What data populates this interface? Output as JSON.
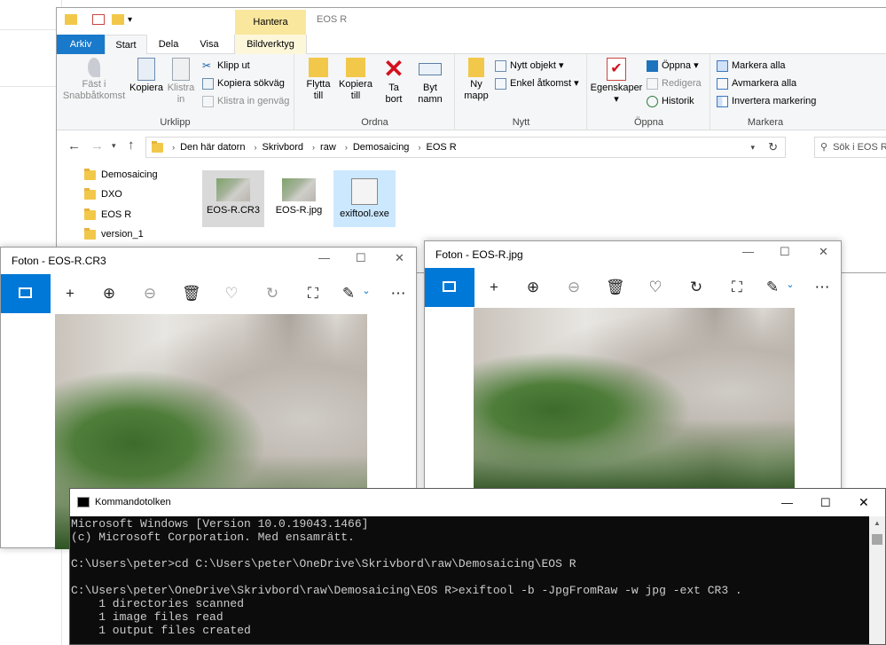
{
  "explorer": {
    "window_title": "EOS R",
    "tool_tab_header": "Hantera",
    "tabs": [
      {
        "label": "Arkiv"
      },
      {
        "label": "Start"
      },
      {
        "label": "Dela"
      },
      {
        "label": "Visa"
      },
      {
        "label": "Bildverktyg"
      }
    ],
    "ribbon": {
      "urklipp": {
        "group_label": "Urklipp",
        "pin_label_1": "Fäst i",
        "pin_label_2": "Snabbåtkomst",
        "copy_label": "Kopiera",
        "paste_label_1": "Klistra",
        "paste_label_2": "in",
        "cut_label": "Klipp ut",
        "copy_path_label": "Kopiera sökväg",
        "paste_shortcut_label": "Klistra in genväg"
      },
      "ordna": {
        "group_label": "Ordna",
        "move_label_1": "Flytta",
        "move_label_2": "till",
        "copyto_label_1": "Kopiera",
        "copyto_label_2": "till",
        "delete_label_1": "Ta",
        "delete_label_2": "bort",
        "rename_label_1": "Byt",
        "rename_label_2": "namn"
      },
      "nytt": {
        "group_label": "Nytt",
        "new_folder_label_1": "Ny",
        "new_folder_label_2": "mapp",
        "new_item_label": "Nytt objekt",
        "easy_access_label": "Enkel åtkomst"
      },
      "oppna": {
        "group_label": "Öppna",
        "properties_label": "Egenskaper",
        "open_label": "Öppna",
        "edit_label": "Redigera",
        "history_label": "Historik"
      },
      "markera": {
        "group_label": "Markera",
        "select_all_label": "Markera alla",
        "select_none_label": "Avmarkera alla",
        "invert_label": "Invertera markering"
      }
    },
    "breadcrumbs": [
      "Den här datorn",
      "Skrivbord",
      "raw",
      "Demosaicing",
      "EOS R"
    ],
    "search_placeholder": "Sök i EOS R",
    "nav_items": [
      "Demosaicing",
      "DXO",
      "EOS R",
      "version_1"
    ],
    "files": [
      {
        "name": "EOS-R.CR3"
      },
      {
        "name": "EOS-R.jpg"
      },
      {
        "name": "exiftool.exe"
      }
    ]
  },
  "photo_left": {
    "title": "Foton - EOS-R.CR3"
  },
  "photo_right": {
    "title": "Foton - EOS-R.jpg"
  },
  "cmd": {
    "title": "Kommandotolken",
    "lines": [
      "Microsoft Windows [Version 10.0.19043.1466]",
      "(c) Microsoft Corporation. Med ensamrätt.",
      "",
      "C:\\Users\\peter>cd C:\\Users\\peter\\OneDrive\\Skrivbord\\raw\\Demosaicing\\EOS R",
      "",
      "C:\\Users\\peter\\OneDrive\\Skrivbord\\raw\\Demosaicing\\EOS R>exiftool -b -JpgFromRaw -w jpg -ext CR3 .",
      "    1 directories scanned",
      "    1 image files read",
      "    1 output files created"
    ]
  },
  "colors": {
    "accent": "#0078d7",
    "arkiv": "#1979ca",
    "tool_tab": "#fae79e",
    "cmd_bg": "#0c0c0c",
    "cmd_text": "#cccccc"
  }
}
